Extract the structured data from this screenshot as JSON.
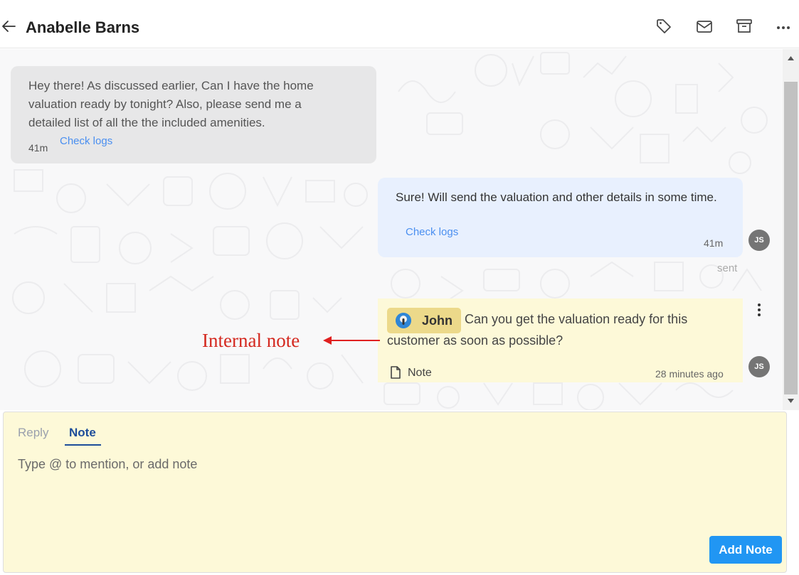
{
  "header": {
    "title": "Anabelle Barns",
    "icons": [
      "back-arrow-icon",
      "tag-icon",
      "mail-icon",
      "archive-icon",
      "more-horizontal-icon"
    ]
  },
  "messages": {
    "incoming": {
      "text": "Hey there! As discussed earlier, Can I have the home valuation ready by tonight? Also, please send me a detailed list of all the the included amenities.",
      "time": "41m",
      "check_logs": "Check logs"
    },
    "outgoing": {
      "text": "Sure! Will send the valuation and other details in some time.",
      "time": "41m",
      "check_logs": "Check logs",
      "avatar_initials": "JS",
      "status": "sent"
    },
    "internal_note": {
      "mention": "John",
      "text_line1": "Can you get the valuation ready for this",
      "text_line2": "customer as soon as possible?",
      "label": "Note",
      "time": "28 minutes ago",
      "avatar_initials": "JS"
    }
  },
  "annotation": {
    "text": "Internal note",
    "color": "#d4281f"
  },
  "composer": {
    "tabs": [
      "Reply",
      "Note"
    ],
    "active_tab": "Note",
    "placeholder": "Type @ to mention, or add note",
    "submit_label": "Add Note"
  },
  "colors": {
    "note_background": "#fdf9d8",
    "mention_background": "#ecd98a",
    "outgoing_bubble": "#e8f0fe",
    "incoming_bubble": "#e7e7e8",
    "link": "#4a8ff0",
    "primary_button": "#2196f3",
    "active_tab": "#1d4d9a"
  }
}
